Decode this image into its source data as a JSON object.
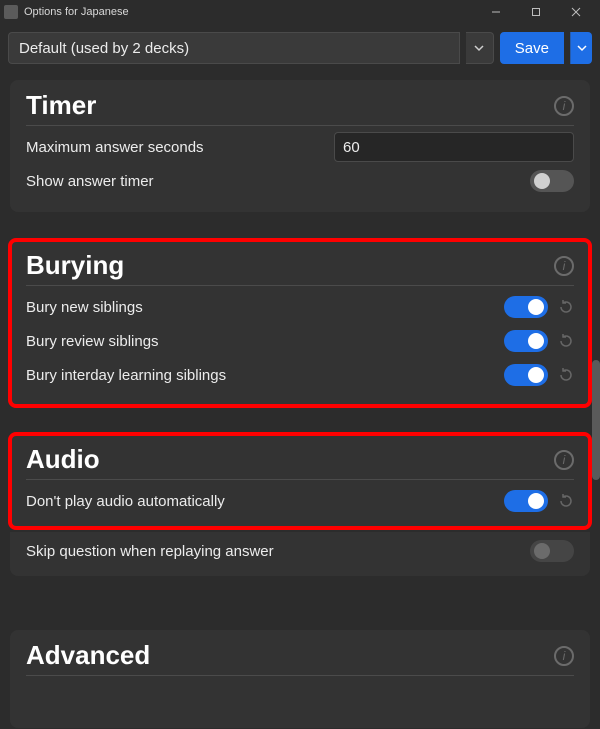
{
  "window": {
    "title": "Options for Japanese"
  },
  "toolbar": {
    "preset_label": "Default (used by 2 decks)",
    "save_label": "Save"
  },
  "timer": {
    "heading": "Timer",
    "max_seconds_label": "Maximum answer seconds",
    "max_seconds_value": "60",
    "show_timer_label": "Show answer timer",
    "show_timer_on": false
  },
  "burying": {
    "heading": "Burying",
    "rows": [
      {
        "label": "Bury new siblings",
        "on": true
      },
      {
        "label": "Bury review siblings",
        "on": true
      },
      {
        "label": "Bury interday learning siblings",
        "on": true
      }
    ]
  },
  "audio": {
    "heading": "Audio",
    "dont_autoplay_label": "Don't play audio automatically",
    "dont_autoplay_on": true,
    "skip_question_label": "Skip question when replaying answer",
    "skip_question_on": false
  },
  "advanced": {
    "heading": "Advanced"
  }
}
